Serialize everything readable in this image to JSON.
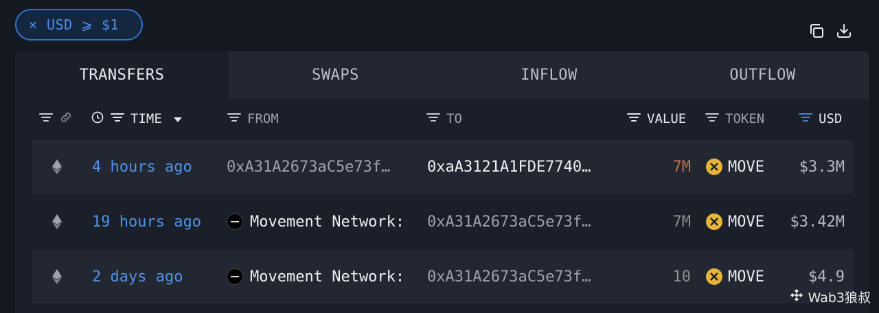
{
  "filter_chip": {
    "close": "×",
    "label": "USD ⩾ $1"
  },
  "tabs": [
    "TRANSFERS",
    "SWAPS",
    "INFLOW",
    "OUTFLOW"
  ],
  "columns": {
    "time": "TIME",
    "from": "FROM",
    "to": "TO",
    "value": "VALUE",
    "token": "TOKEN",
    "usd": "USD"
  },
  "rows": [
    {
      "time": "4 hours ago",
      "from": "0xA31A2673aC5e73f…",
      "to": "0xaA3121A1FDE7740…",
      "value": "7M",
      "token": "MOVE",
      "usd": "$3.3M"
    },
    {
      "time": "19 hours ago",
      "from": "Movement Network:",
      "to": "0xA31A2673aC5e73f…",
      "value": "7M",
      "token": "MOVE",
      "usd": "$3.42M"
    },
    {
      "time": "2 days ago",
      "from": "Movement Network:",
      "to": "0xA31A2673aC5e73f…",
      "value": "10",
      "token": "MOVE",
      "usd": "$4.9"
    }
  ],
  "watermark": "Wab3狼叔",
  "colors": {
    "accent": "#4f93e6",
    "chip_border": "#2e72c9",
    "value_highlight": "#c0734a",
    "token_coin": "#e7b43a"
  }
}
